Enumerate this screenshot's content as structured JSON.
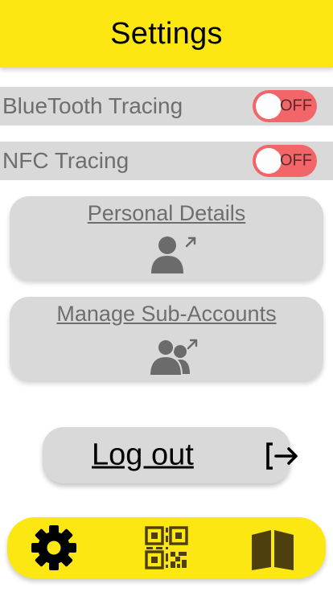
{
  "header": {
    "title": "Settings"
  },
  "toggles": [
    {
      "label": "BlueTooth Tracing",
      "state": "OFF",
      "on": false
    },
    {
      "label": "NFC Tracing",
      "state": "OFF",
      "on": false
    }
  ],
  "cards": [
    {
      "label": "Personal Details",
      "icon": "person-link-icon"
    },
    {
      "label": "Manage Sub-Accounts",
      "icon": "people-link-icon"
    }
  ],
  "logout": {
    "label": "Log out",
    "icon": "logout-arrow-icon"
  },
  "navbar": {
    "items": [
      {
        "name": "settings",
        "icon": "gear-icon"
      },
      {
        "name": "qr-code",
        "icon": "qr-code-icon"
      },
      {
        "name": "book",
        "icon": "open-book-icon"
      }
    ]
  },
  "colors": {
    "accent": "#fde713",
    "toggle_off": "#f26569",
    "panel": "#d9d9d9",
    "muted_text": "#6e6e6e"
  }
}
